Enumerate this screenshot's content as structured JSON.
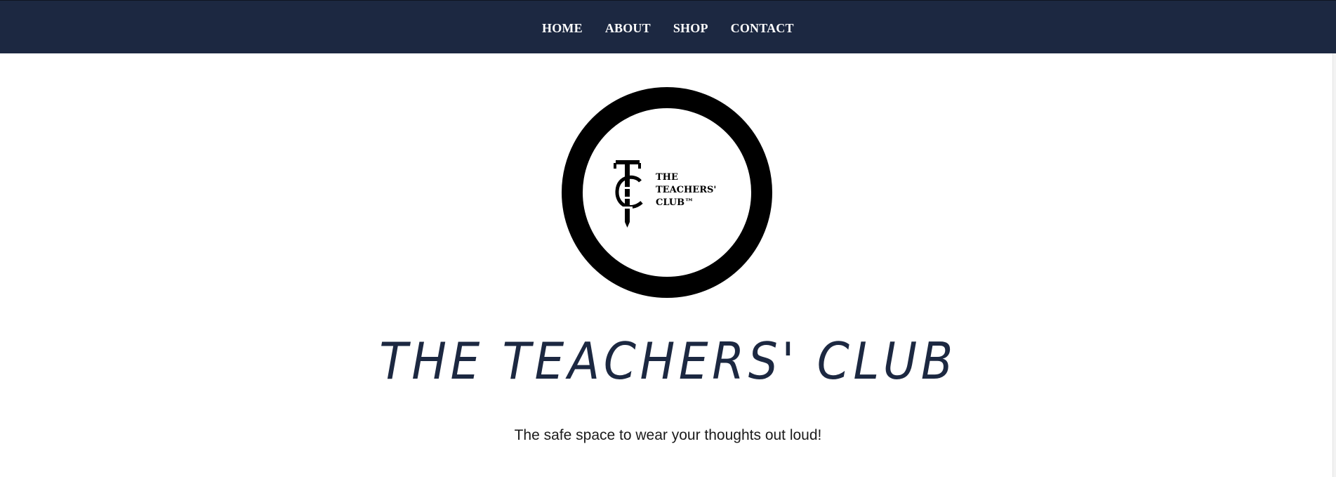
{
  "nav": {
    "items": [
      {
        "label": "HOME"
      },
      {
        "label": "ABOUT"
      },
      {
        "label": "SHOP"
      },
      {
        "label": "CONTACT"
      }
    ]
  },
  "logo": {
    "monogram": "TC",
    "text_lines": [
      "THE",
      "TEACHERS'",
      "CLUB™"
    ]
  },
  "hero": {
    "title": "THE TEACHERS' CLUB",
    "tagline": "The safe space to wear your thoughts out loud!"
  },
  "colors": {
    "nav_background": "#1c2841",
    "title_color": "#1c2841",
    "logo_ring": "#000000"
  }
}
